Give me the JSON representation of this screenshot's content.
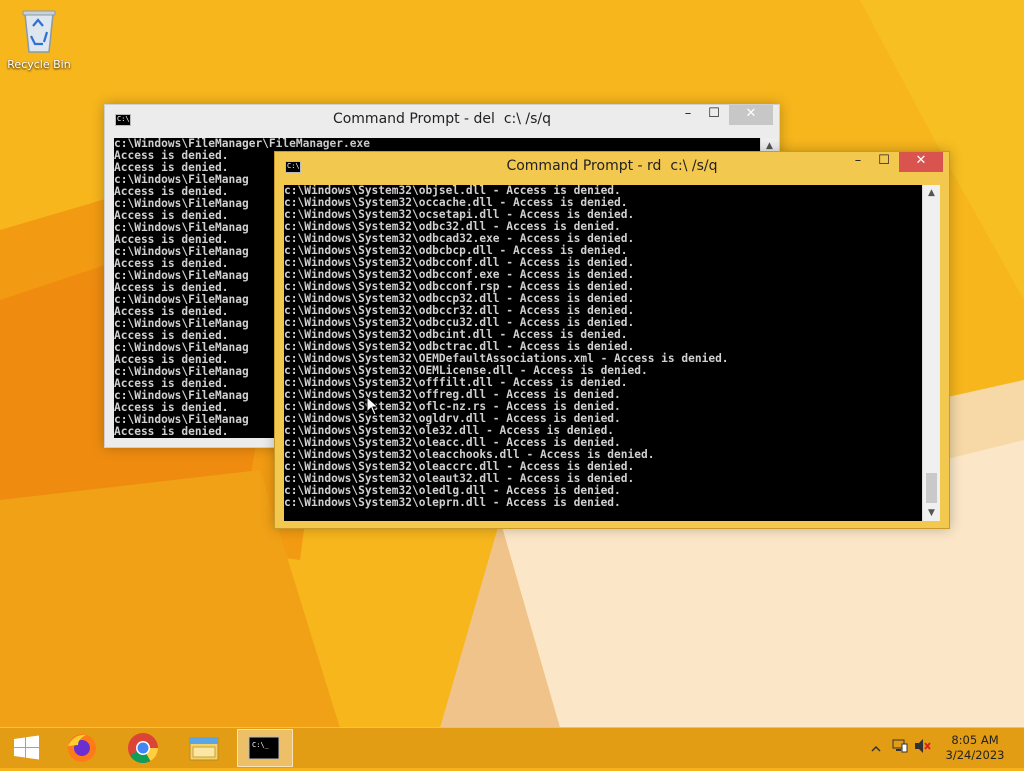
{
  "desktop": {
    "icons": [
      {
        "label": "Recycle Bin",
        "icon": "recycle-bin-icon"
      }
    ]
  },
  "windows": {
    "back": {
      "title": "Command Prompt - del  c:\\ /s/q",
      "lines": [
        "c:\\Windows\\FileManager\\FileManager.exe",
        "Access is denied.",
        "Access is denied.",
        "c:\\Windows\\FileManag",
        "Access is denied.",
        "c:\\Windows\\FileManag",
        "Access is denied.",
        "c:\\Windows\\FileManag",
        "Access is denied.",
        "c:\\Windows\\FileManag",
        "Access is denied.",
        "c:\\Windows\\FileManag",
        "Access is denied.",
        "c:\\Windows\\FileManag",
        "Access is denied.",
        "c:\\Windows\\FileManag",
        "Access is denied.",
        "c:\\Windows\\FileManag",
        "Access is denied.",
        "c:\\Windows\\FileManag",
        "Access is denied.",
        "c:\\Windows\\FileManag",
        "Access is denied.",
        "c:\\Windows\\FileManag",
        "Access is denied."
      ]
    },
    "front": {
      "title": "Command Prompt - rd  c:\\ /s/q",
      "lines": [
        "c:\\Windows\\System32\\objsel.dll - Access is denied.",
        "c:\\Windows\\System32\\occache.dll - Access is denied.",
        "c:\\Windows\\System32\\ocsetapi.dll - Access is denied.",
        "c:\\Windows\\System32\\odbc32.dll - Access is denied.",
        "c:\\Windows\\System32\\odbcad32.exe - Access is denied.",
        "c:\\Windows\\System32\\odbcbcp.dll - Access is denied.",
        "c:\\Windows\\System32\\odbcconf.dll - Access is denied.",
        "c:\\Windows\\System32\\odbcconf.exe - Access is denied.",
        "c:\\Windows\\System32\\odbcconf.rsp - Access is denied.",
        "c:\\Windows\\System32\\odbccp32.dll - Access is denied.",
        "c:\\Windows\\System32\\odbccr32.dll - Access is denied.",
        "c:\\Windows\\System32\\odbccu32.dll - Access is denied.",
        "c:\\Windows\\System32\\odbcint.dll - Access is denied.",
        "c:\\Windows\\System32\\odbctrac.dll - Access is denied.",
        "c:\\Windows\\System32\\OEMDefaultAssociations.xml - Access is denied.",
        "c:\\Windows\\System32\\OEMLicense.dll - Access is denied.",
        "c:\\Windows\\System32\\offfilt.dll - Access is denied.",
        "c:\\Windows\\System32\\offreg.dll - Access is denied.",
        "c:\\Windows\\System32\\oflc-nz.rs - Access is denied.",
        "c:\\Windows\\System32\\ogldrv.dll - Access is denied.",
        "c:\\Windows\\System32\\ole32.dll - Access is denied.",
        "c:\\Windows\\System32\\oleacc.dll - Access is denied.",
        "c:\\Windows\\System32\\oleacchooks.dll - Access is denied.",
        "c:\\Windows\\System32\\oleaccrc.dll - Access is denied.",
        "c:\\Windows\\System32\\oleaut32.dll - Access is denied.",
        "c:\\Windows\\System32\\oledlg.dll - Access is denied.",
        "c:\\Windows\\System32\\oleprn.dll - Access is denied."
      ]
    },
    "controls": {
      "minimize": "–",
      "maximize": "☐",
      "close": "✕"
    }
  },
  "taskbar": {
    "items": [
      {
        "name": "start-button",
        "icon": "windows-logo-icon"
      },
      {
        "name": "taskbar-firefox",
        "icon": "firefox-icon"
      },
      {
        "name": "taskbar-chrome",
        "icon": "chrome-icon"
      },
      {
        "name": "taskbar-file-explorer",
        "icon": "file-explorer-icon"
      },
      {
        "name": "taskbar-command-prompt",
        "icon": "command-prompt-icon",
        "active": true
      }
    ],
    "tray": {
      "time": "8:05 AM",
      "date": "3/24/2023",
      "icons": [
        "show-hidden-icons-icon",
        "network-icon",
        "volume-muted-icon"
      ]
    }
  },
  "colors": {
    "wallpaper": "#f6b21a",
    "active_title": "#f3c84e",
    "close_active": "#d9534f"
  }
}
